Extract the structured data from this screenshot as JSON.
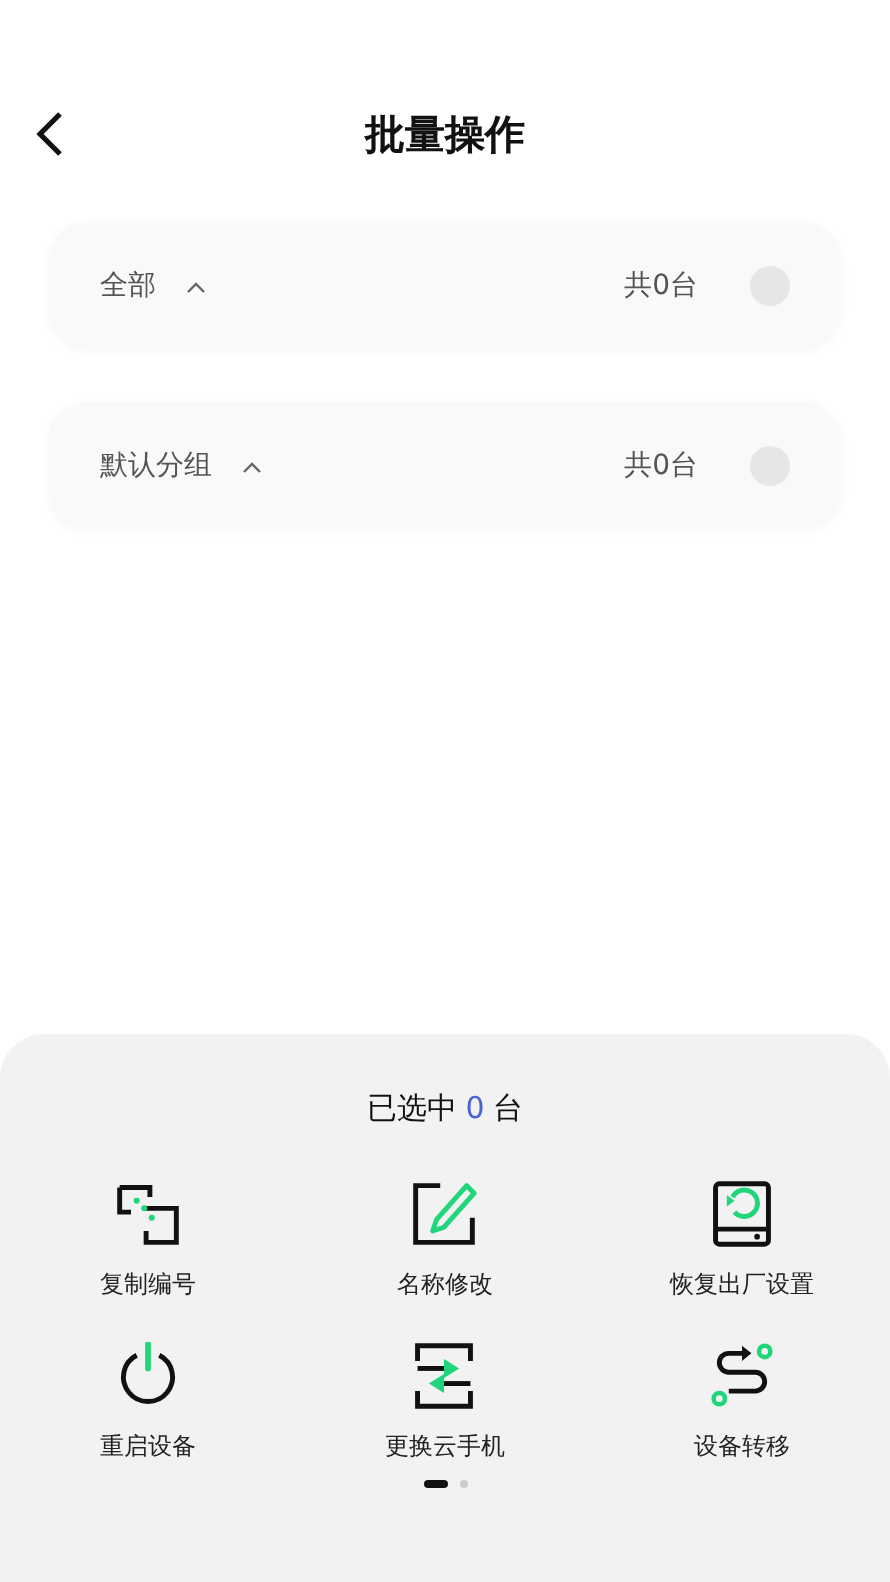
{
  "header": {
    "title": "批量操作"
  },
  "groups": [
    {
      "name": "全部",
      "expanded": true,
      "count": "共0台",
      "checked": false
    },
    {
      "name": "默认分组",
      "expanded": true,
      "count": "共0台",
      "checked": false
    }
  ],
  "sheet": {
    "selected_prefix": "已选中",
    "selected_count": "0",
    "selected_suffix": "台",
    "actions": [
      {
        "kind": "copy",
        "label": "复制编号"
      },
      {
        "kind": "edit",
        "label": "名称修改"
      },
      {
        "kind": "reset",
        "label": "恢复出厂设置"
      },
      {
        "kind": "power",
        "label": "重启设备"
      },
      {
        "kind": "swap",
        "label": "更换云手机"
      },
      {
        "kind": "transfer",
        "label": "设备转移"
      }
    ],
    "pages": [
      {
        "selected": true
      },
      {
        "selected": false
      }
    ]
  }
}
